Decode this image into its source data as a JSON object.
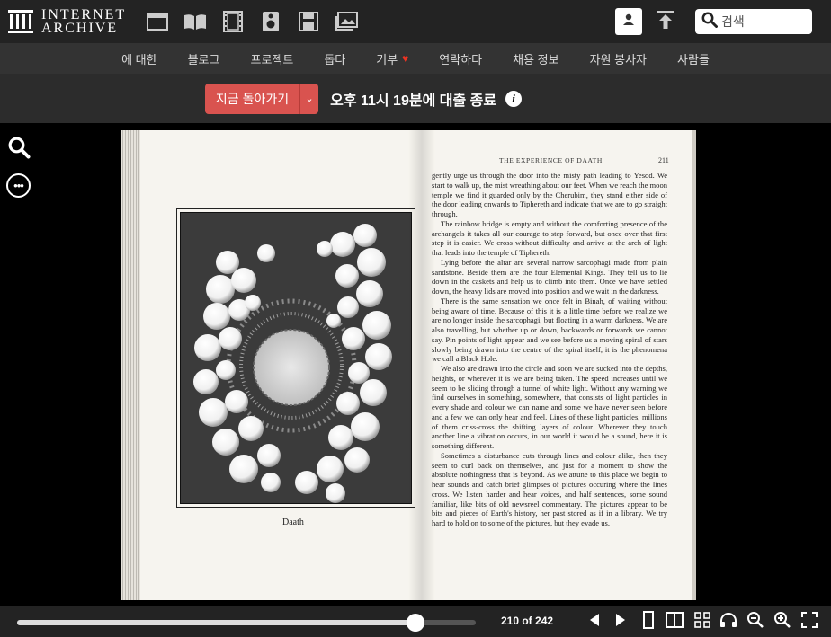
{
  "header": {
    "logo_line1": "INTERNET",
    "logo_line2": "ARCHIVE",
    "media_icons": [
      "web-icon",
      "texts-icon",
      "video-icon",
      "audio-icon",
      "software-icon",
      "images-icon"
    ],
    "search_placeholder": "검색"
  },
  "nav": {
    "items": [
      "에 대한",
      "블로그",
      "프로젝트",
      "돕다",
      "기부",
      "연락하다",
      "채용 정보",
      "자원 봉사자",
      "사람들"
    ],
    "donate_heart": "♥"
  },
  "loan": {
    "return_label": "지금 돌아가기",
    "caret": "⌄",
    "status_text": "오후 11시 19분에 대출 종료",
    "info_glyph": "i"
  },
  "book": {
    "caption": "Daath",
    "running_head": "THE EXPERIENCE OF DAATH",
    "page_number": "211",
    "paragraphs": [
      "gently urge us through the door into the misty path leading to Yesod. We start to walk up, the mist wreathing about our feet. When we reach the moon temple we find it guarded only by the Cherubim, they stand either side of the door leading onwards to Tiphereth and indicate that we are to go straight through.",
      "The rainbow bridge is empty and without the comforting presence of the archangels it takes all our courage to step forward, but once over that first step it is easier. We cross without difficulty and arrive at the arch of light that leads into the temple of Tiphereth.",
      "Lying before the altar are several narrow sarcophagi made from plain sandstone. Beside them are the four Elemental Kings. They tell us to lie down in the caskets and help us to climb into them. Once we have settled down, the heavy lids are moved into position and we wait in the darkness.",
      "There is the same sensation we once felt in Binah, of waiting without being aware of time. Because of this it is a little time before we realize we are no longer inside the sarcophagi, but floating in a warm darkness. We are also travelling, but whether up or down, backwards or forwards we cannot say. Pin points of light appear and we see before us a moving spiral of stars slowly being drawn into the centre of the spiral itself, it is the phenomena we call a Black Hole.",
      "We also are drawn into the circle and soon we are sucked into the depths, heights, or wherever it is we are being taken. The speed increases until we seem to be sliding through a tunnel of white light. Without any warning we find ourselves in something, somewhere, that consists of light particles in every shade and colour we can name and some we have never seen before and a few we can only hear and feel. Lines of these light particles, millions of them criss-cross the shifting layers of colour. Wherever they touch another line a vibration occurs, in our world it would be a sound, here it is something different.",
      "Sometimes a disturbance cuts through lines and colour alike, then they seem to curl back on themselves, and just for a moment to show the absolute nothingness that is beyond. As we attune to this place we begin to hear sounds and catch brief glimpses of pictures occuring where the lines cross. We listen harder and hear voices, and half sentences, some sound familiar, like bits of old newsreel commentary. The pictures appear to be bits and pieces of Earth's history, her past stored as if in a library. We try hard to hold on to some of the pictures, but they evade us."
    ]
  },
  "reader": {
    "current_page": 210,
    "total_pages": 242,
    "page_counter": "210 of 242",
    "progress_fraction": 0.868
  }
}
